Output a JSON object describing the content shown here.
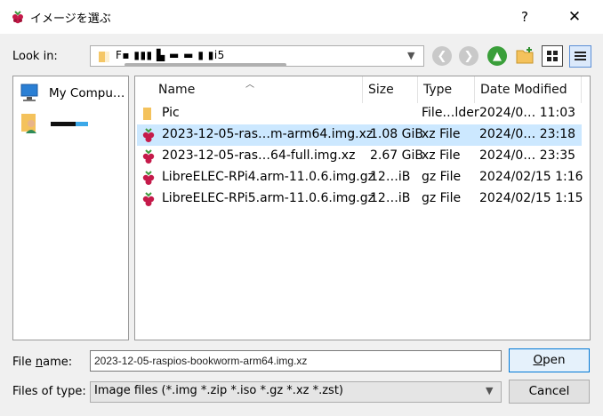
{
  "window": {
    "title": "イメージを選ぶ",
    "help_label": "?",
    "close_label": "✕"
  },
  "lookin": {
    "label": "Look in:",
    "value": "F▪ ▮▮▮ ▙ ▬ ▬ ▮ ▮i5"
  },
  "toolbar": {
    "back_icon": "back-arrow-icon",
    "forward_icon": "forward-arrow-icon",
    "up_icon": "up-arrow-icon",
    "new_folder_icon": "new-folder-icon",
    "list_view_icon": "list-view-icon",
    "detail_view_icon": "detail-view-icon"
  },
  "sidebar": {
    "items": [
      {
        "label": "My Compu…",
        "icon": "computer-icon"
      },
      {
        "label": "",
        "icon": "user-folder-icon"
      }
    ]
  },
  "files": {
    "columns": [
      "Name",
      "Size",
      "Type",
      "Date Modified"
    ],
    "rows": [
      {
        "name": "Pic",
        "size": "",
        "type": "File…lder",
        "date": "2024/0… 11:03",
        "icon": "folder-icon"
      },
      {
        "name": "2023-12-05-ras…m-arm64.img.xz",
        "size": "1.08 GiB",
        "type": "xz File",
        "date": "2024/0… 23:18",
        "icon": "raspberry-icon"
      },
      {
        "name": "2023-12-05-ras…64-full.img.xz",
        "size": "2.67 GiB",
        "type": "xz File",
        "date": "2024/0… 23:35",
        "icon": "raspberry-icon"
      },
      {
        "name": "LibreELEC-RPi4.arm-11.0.6.img.gz",
        "size": "12…iB",
        "type": "gz File",
        "date": "2024/02/15 1:16",
        "icon": "raspberry-icon"
      },
      {
        "name": "LibreELEC-RPi5.arm-11.0.6.img.gz",
        "size": "12…iB",
        "type": "gz File",
        "date": "2024/02/15 1:15",
        "icon": "raspberry-icon"
      }
    ]
  },
  "bottom": {
    "filename_label_pre": "File ",
    "filename_label_ul": "n",
    "filename_label_post": "ame:",
    "filename_value": "2023-12-05-raspios-bookworm-arm64.img.xz",
    "open_ul": "O",
    "open_post": "pen",
    "filetype_label": "Files of type:",
    "filetype_value": "Image files (*.img *.zip *.iso *.gz *.xz *.zst)",
    "cancel_label": "Cancel"
  },
  "colors": {
    "selected_row": "#cce8ff",
    "open_border": "#0078d7",
    "raspberry": "#c51a4a",
    "folder": "#f4c25c"
  }
}
